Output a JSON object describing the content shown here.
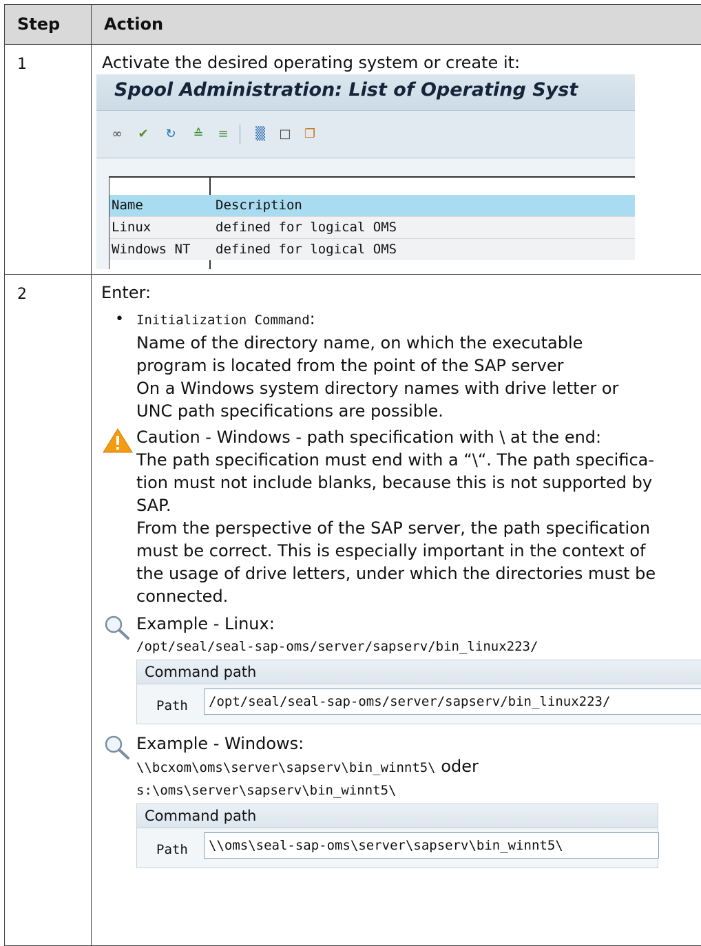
{
  "table": {
    "headers": {
      "step": "Step",
      "action": "Action"
    },
    "rows": [
      {
        "step": "1",
        "intro": "Activate the desired operating system or create it:",
        "sap": {
          "title": "Spool Administration: List of Operating Syst",
          "toolbar_icons": [
            "glasses-icon",
            "activate-icon",
            "refresh-icon",
            "sort-ascending-icon",
            "filter-icon",
            "delete-icon",
            "new-document-icon",
            "copy-icon"
          ],
          "columns": [
            "Name",
            "Description"
          ],
          "rows": [
            {
              "name": "Linux",
              "description": "defined for logical OMS"
            },
            {
              "name": "Windows NT",
              "description": "defined for logical OMS"
            }
          ]
        }
      },
      {
        "step": "2",
        "intro": "Enter:",
        "bullet": {
          "term": "Initialization Command",
          "colon": ":",
          "lines": [
            "Name of the directory name, on which the executable",
            "program is located from the point of the SAP server",
            "On a Windows system directory names with drive letter or",
            "UNC path specifications are possible."
          ]
        },
        "caution": {
          "lines": [
            "Caution - Windows - path specification with \\ at the end:",
            "The path specification must end with a “\\“. The path specifica-",
            "tion must not include blanks, because this is not supported by",
            "SAP.",
            "From the perspective of the SAP server, the path specification",
            "must be correct. This is especially important in the context of",
            "the usage of drive letters, under which the directories must be",
            "connected."
          ]
        },
        "example_linux": {
          "heading": "Example - Linux:",
          "path": "/opt/seal/seal-sap-oms/server/sapserv/bin_linux223/",
          "box": {
            "group_label": "Command path",
            "field_label": "Path",
            "field_value": "/opt/seal/seal-sap-oms/server/sapserv/bin_linux223/"
          }
        },
        "example_windows": {
          "heading": "Example - Windows:",
          "path1": "\\\\bcxom\\oms\\server\\sapserv\\bin_winnt5\\",
          "connector": " oder",
          "path2": "s:\\oms\\server\\sapserv\\bin_winnt5\\",
          "box": {
            "group_label": "Command path",
            "field_label": "Path",
            "field_value": "\\\\oms\\seal-sap-oms\\server\\sapserv\\bin_winnt5\\"
          }
        }
      }
    ]
  }
}
